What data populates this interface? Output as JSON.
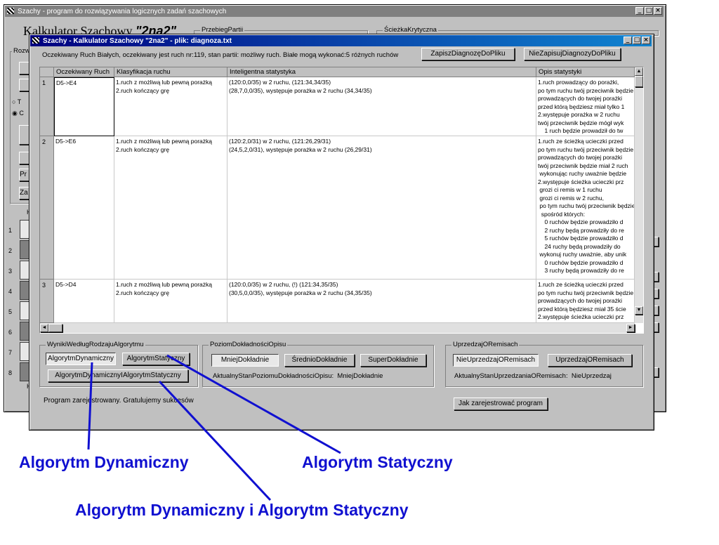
{
  "back_window": {
    "title": "Szachy - program do rozwiązywania logicznych zadań szachowych",
    "heading": "Kalkulator Szachowy",
    "heading_highlight": "\"2na2\"",
    "group_przebieg": "PrzebiegPartii",
    "group_sciezka": "ŚcieżkaKrytyczna",
    "group_rozw_partial": "Rozw",
    "radio_t": "T",
    "radio_c": "C",
    "btn_pr": "Pr",
    "btn_za": "Za",
    "h_label": "H",
    "rank_numbers": [
      "1",
      "2",
      "3",
      "4",
      "5",
      "6",
      "7",
      "8"
    ]
  },
  "dialog": {
    "title": "Szachy - Kalkulator Szachowy \"2na2\" - plik: diagnoza.txt",
    "status_line": "Oczekiwany Ruch Białych, oczekiwany jest ruch nr:119, stan partii: możliwy ruch. Białe mogą wykonać:5 różnych ruchów",
    "save_button": "ZapiszDiagnozęDoPliku",
    "nosave_button": "NieZapisujDiagnozyDoPliku",
    "columns": [
      "Oczekiwany Ruch",
      "Klasyfikacja ruchu",
      "Inteligentna statystyka",
      "Opis statystyki"
    ],
    "rows": [
      {
        "num": "1",
        "move": "D5->E4",
        "classification": "1.ruch z możliwą lub pewną porażką\n2.ruch kończący grę",
        "stats": "(120:0,0/35) w 2 ruchu, (121:34,34/35)\n(28,7,0,0/35), występuje porażka w 2 ruchu (34,34/35)",
        "description": "1.ruch prowadzący do porażki,\npo tym ruchu twój przeciwnik będzie\nprowadzących do twojej porażki\nprzed którą będziesz miał tylko 1\n2.występuje porażka w 2 ruchu\ntwój przeciwnik będzie mógł wyk\n    1 ruch będzie prowadził do tw"
      },
      {
        "num": "2",
        "move": "D5->E6",
        "classification": "1.ruch z możliwą lub pewną porażką\n2.ruch kończący grę",
        "stats": "(120:2,0/31) w 2 ruchu, (121:26,29/31)\n(24,5,2,0/31), występuje porażka w 2 ruchu (26,29/31)",
        "description": "1.ruch ze ścieżką ucieczki przed\npo tym ruchu twój przeciwnik będzie\nprowadzących do twojej porażki\ntwój przeciwnik będzie miał 2 ruch\n wykonując ruchy uważnie będzie\n2.występuje ścieżka ucieczki prz\n grozi ci remis w 1 ruchu\n grozi ci remis w 2 ruchu,\n po tym ruchu twój przeciwnik będzie\n  spośród których:\n    0 ruchów będzie prowadziło d\n    2 ruchy będą prowadziły do re\n    5 ruchów będzie prowadziło d\n    24 ruchy będą prowadziły do\n wykonuj ruchy uważnie, aby unik\n    0 ruchów będzie prowadziło d\n    3 ruchy będą prowadziły do re"
      },
      {
        "num": "3",
        "move": "D5->D4",
        "classification": "1.ruch z możliwą lub pewną porażką\n2.ruch kończący grę",
        "stats": "(120:0,0/35) w 2 ruchu, (!) (121:34,35/35)\n(30,5,0,0/35), występuje porażka w 2 ruchu (34,35/35)",
        "description": "1.ruch ze ścieżką ucieczki przed\npo tym ruchu twój przeciwnik będzie\nprowadzących do twojej porażki\nprzed którą będziesz miał 35 ście\n2.występuje ścieżka ucieczki prz"
      }
    ],
    "group_algorithm": {
      "label": "WynikiWedługRodzajuAlgorytmu",
      "btn_dynamic": "AlgorytmDynamiczny",
      "btn_static": "AlgorytmStatyczny",
      "btn_both": "AlgorytmDynamicznyIAlgorytmStatyczny"
    },
    "group_accuracy": {
      "label": "PoziomDokładnościOpisu",
      "btn_less": "MniejDokładnie",
      "btn_medium": "ŚrednioDokładnie",
      "btn_super": "SuperDokładnie",
      "status": "AktualnyStanPoziomuDokładnościOpisu:  MniejDokładnie"
    },
    "group_remis": {
      "label": "UprzedzajORemisach",
      "btn_no": "NieUprzedzajORemisach",
      "btn_yes": "UprzedzajORemisach",
      "status": "AktualnyStanUprzedzaniaORemisach:  NieUprzedzaj"
    },
    "registered": "Program zarejestrowany. Gratulujemy sukcesów",
    "register_button": "Jak zarejestrować program"
  },
  "annotations": {
    "dynamic": "Algorytm Dynamiczny",
    "static": "Algorytm Statyczny",
    "both": "Algorytm Dynamiczny i Algorytm Statyczny"
  },
  "colors": {
    "annotation": "#1010d0",
    "title_active": "#000080",
    "title_inactive": "#808080"
  }
}
